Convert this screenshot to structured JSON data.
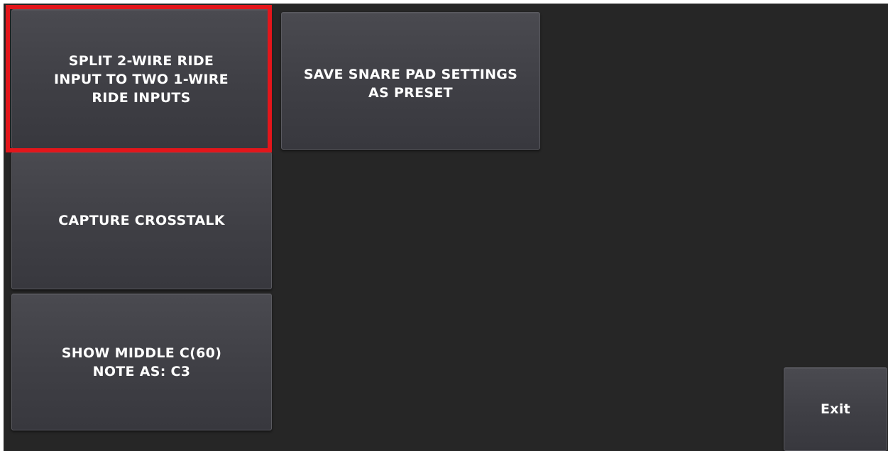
{
  "buttons": {
    "split_ride": "SPLIT 2-WIRE RIDE\nINPUT TO TWO 1-WIRE\nRIDE INPUTS",
    "save_preset": "SAVE SNARE PAD SETTINGS\nAS PRESET",
    "capture_crosstalk": "CAPTURE CROSSTALK",
    "show_middle_c": "SHOW MIDDLE C(60)\nNOTE AS: C3",
    "exit": "Exit"
  },
  "colors": {
    "background": "#262626",
    "button": "#424248",
    "text": "#ffffff",
    "highlight": "#e3161b"
  }
}
